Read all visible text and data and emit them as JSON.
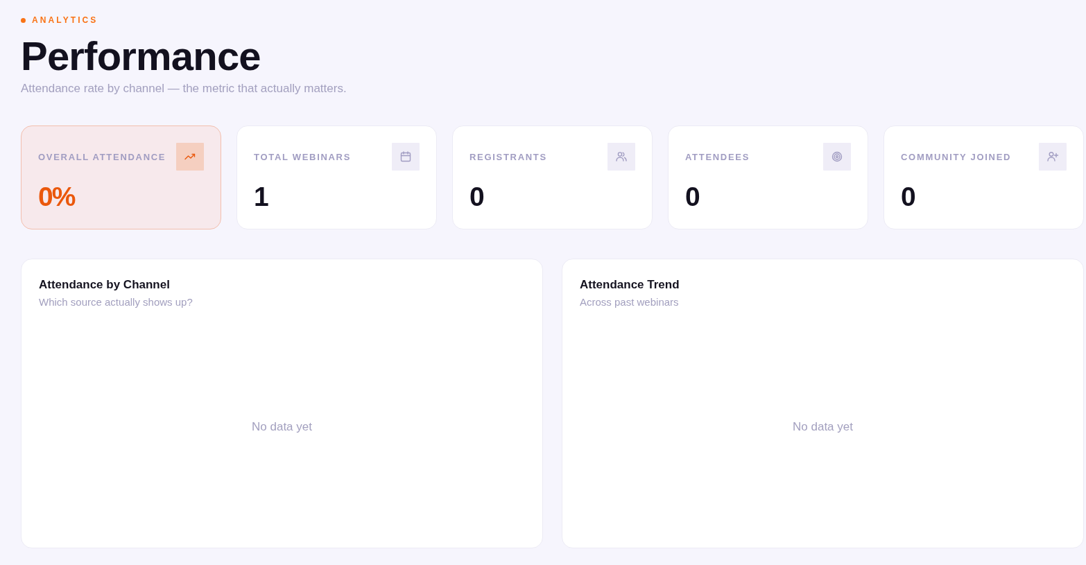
{
  "header": {
    "eyebrow": "ANALYTICS",
    "title": "Performance",
    "subtitle": "Attendance rate by channel — the metric that actually matters."
  },
  "stats": [
    {
      "label": "OVERALL ATTENDANCE",
      "value": "0%",
      "highlighted": true
    },
    {
      "label": "TOTAL WEBINARS",
      "value": "1",
      "highlighted": false
    },
    {
      "label": "REGISTRANTS",
      "value": "0",
      "highlighted": false
    },
    {
      "label": "ATTENDEES",
      "value": "0",
      "highlighted": false
    },
    {
      "label": "COMMUNITY JOINED",
      "value": "0",
      "highlighted": false
    }
  ],
  "panels": [
    {
      "title": "Attendance by Channel",
      "subtitle": "Which source actually shows up?",
      "empty_message": "No data yet"
    },
    {
      "title": "Attendance Trend",
      "subtitle": "Across past webinars",
      "empty_message": "No data yet"
    }
  ]
}
